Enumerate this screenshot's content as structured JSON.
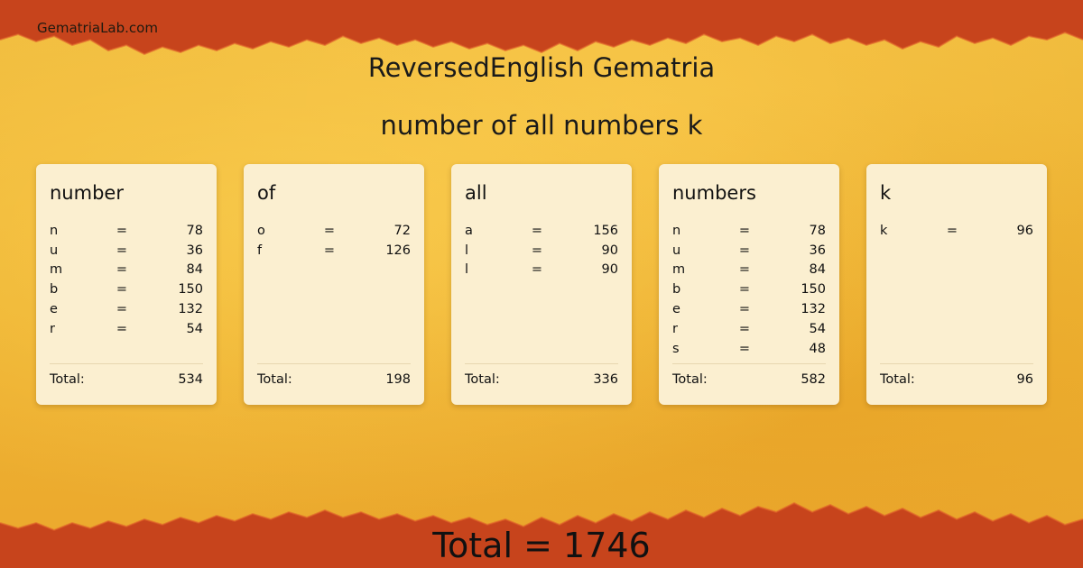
{
  "site": {
    "name": "GematriaLab.com"
  },
  "title": "ReversedEnglish Gematria",
  "phrase": "number of all numbers k",
  "total_label": "Total:",
  "grand_total": "Total = 1746",
  "colors": {
    "border": "#c7441c",
    "background": "#f0b93a",
    "card": "#fbefd0"
  },
  "words": [
    {
      "word": "number",
      "total": "534",
      "letters": [
        {
          "ch": "n",
          "val": "78"
        },
        {
          "ch": "u",
          "val": "36"
        },
        {
          "ch": "m",
          "val": "84"
        },
        {
          "ch": "b",
          "val": "150"
        },
        {
          "ch": "e",
          "val": "132"
        },
        {
          "ch": "r",
          "val": "54"
        }
      ]
    },
    {
      "word": "of",
      "total": "198",
      "letters": [
        {
          "ch": "o",
          "val": "72"
        },
        {
          "ch": "f",
          "val": "126"
        }
      ]
    },
    {
      "word": "all",
      "total": "336",
      "letters": [
        {
          "ch": "a",
          "val": "156"
        },
        {
          "ch": "l",
          "val": "90"
        },
        {
          "ch": "l",
          "val": "90"
        }
      ]
    },
    {
      "word": "numbers",
      "total": "582",
      "letters": [
        {
          "ch": "n",
          "val": "78"
        },
        {
          "ch": "u",
          "val": "36"
        },
        {
          "ch": "m",
          "val": "84"
        },
        {
          "ch": "b",
          "val": "150"
        },
        {
          "ch": "e",
          "val": "132"
        },
        {
          "ch": "r",
          "val": "54"
        },
        {
          "ch": "s",
          "val": "48"
        }
      ]
    },
    {
      "word": "k",
      "total": "96",
      "letters": [
        {
          "ch": "k",
          "val": "96"
        }
      ]
    }
  ]
}
